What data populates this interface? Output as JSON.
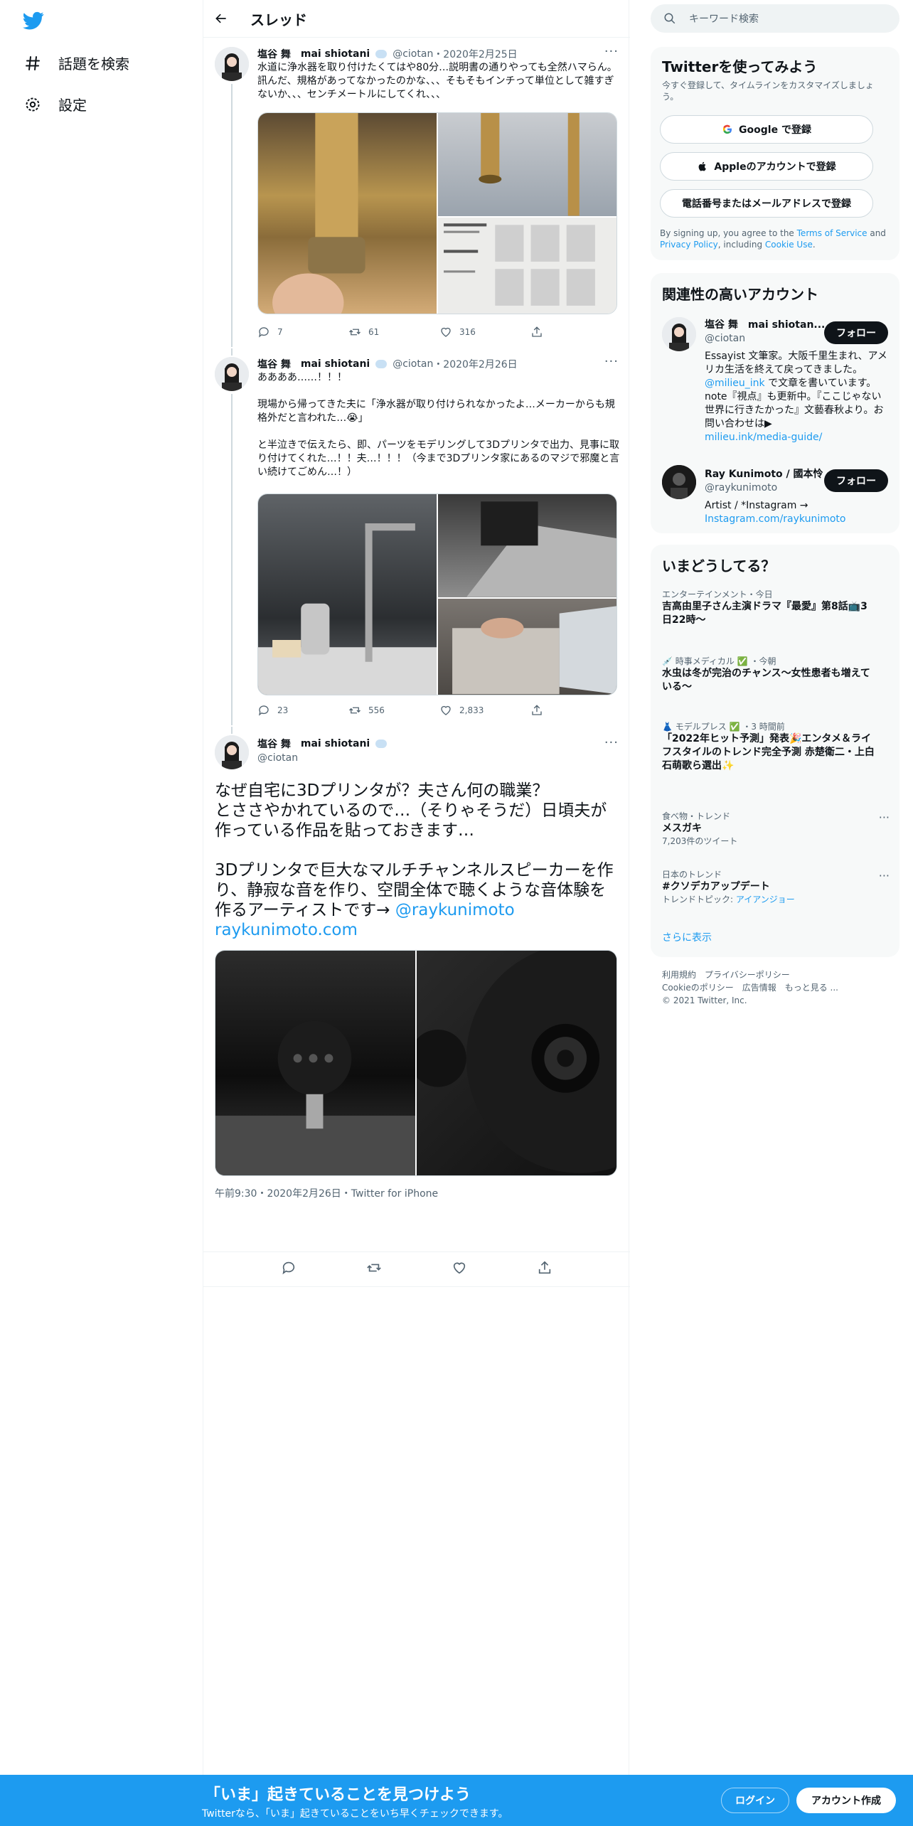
{
  "nav": {
    "explore_label": "話題を検索",
    "settings_label": "設定"
  },
  "header": {
    "title": "スレッド"
  },
  "tweets": [
    {
      "name": "塩谷 舞",
      "name_en": "mai shiotani",
      "handle": "@ciotan",
      "date": "・2020年2月25日",
      "text": "水道に浄水器を取り付けたくてはや80分…説明書の通りやっても全然ハマらん。訊んだ、規格があってなかったのかな、、、そもそもインチって単位として雑すぎないか、、、センチメートルにしてくれ、、、",
      "replies": "7",
      "retweets": "61",
      "likes": "316"
    },
    {
      "name": "塩谷 舞",
      "name_en": "mai shiotani",
      "handle": "@ciotan",
      "date": "・2020年2月26日",
      "text": "ああああ……！！！\n\n現場から帰ってきた夫に「浄水器が取り付けられなかったよ…メーカーからも規格外だと言われた…😭」\n\nと半泣きで伝えたら、即、パーツをモデリングして3Dプリンタで出力、見事に取り付けてくれた…！！夫…！！！（今まで3Dプリンタ家にあるのマジで邪魔と言い続けてごめん…！）",
      "replies": "23",
      "retweets": "556",
      "likes": "2,833"
    }
  ],
  "main_tweet": {
    "name": "塩谷 舞",
    "name_en": "mai shiotani",
    "handle": "@ciotan",
    "text": "なぜ自宅に3Dプリンタが？夫さん何の職業？\nとささやかれているので…（そりゃそうだ）日頃夫が作っている作品を貼っておきます…\n\n3Dプリンタで巨大なマルチチャンネルスピーカーを作り、静寂な音を作り、空間全体で聴くような音体験を作るアーティストです→ ",
    "mention": "@raykunimoto",
    "url": "raykunimoto.com",
    "timestamp": "午前9:30・2020年2月26日・Twitter for iPhone"
  },
  "sidebar": {
    "search_placeholder": "キーワード検索",
    "signup": {
      "title": "Twitterを使ってみよう",
      "subtitle": "今すぐ登録して、タイムラインをカスタマイズしましょう。",
      "google": "Google で登録",
      "apple": "Appleのアカウントで登録",
      "phone": "電話番号またはメールアドレスで登録",
      "terms_pre": "By signing up, you agree to the ",
      "terms_link": "Terms of Service",
      "terms_and": " and ",
      "privacy_link": "Privacy Policy",
      "including": ", including ",
      "cookie_link": "Cookie Use",
      "period": "."
    },
    "related": {
      "title": "関連性の高いアカウント",
      "follow_label": "フォロー",
      "accounts": [
        {
          "name": "塩谷 舞　mai shiotan...",
          "handle": "@ciotan",
          "bio": "Essayist 文筆家。大阪千里生まれ、アメリカ生活を終えて戻ってきました。",
          "bio_link": "@milieu_ink",
          "bio_rest": " で文章を書いています。note『視点』も更新中。『ここじゃない世界に行きたかった』文藝春秋より。お問い合わせは▶",
          "bio_url": "milieu.ink/media-guide/"
        },
        {
          "name": "Ray Kunimoto / 國本怜",
          "handle": "@raykunimoto",
          "bio": "Artist / *Instagram →",
          "bio_url": "Instagram.com/raykunimoto"
        }
      ]
    },
    "trends": {
      "title": "いまどうしてる？",
      "items": [
        {
          "cat": "エンターテインメント・今日",
          "name": "吉高由里子さん主演ドラマ『最愛』第8話📺3日22時〜",
          "sub": ""
        },
        {
          "cat": "💉 時事メディカル ✅ ・今朝",
          "name": "水虫は冬が完治のチャンス～女性患者も増えている～",
          "sub": ""
        },
        {
          "cat": "👗 モデルプレス ✅ ・3 時間前",
          "name": "「2022年ヒット予測」発表🎉エンタメ＆ライフスタイルのトレンド完全予測 赤楚衛二・上白石萌歌ら選出✨",
          "sub": ""
        },
        {
          "cat": "食べ物・トレンド",
          "name": "メスガキ",
          "sub": "7,203件のツイート"
        },
        {
          "cat": "日本のトレンド",
          "name": "#クソデカアップデート",
          "sub_pre": "トレンドトピック: ",
          "sub_link": "アイアンジョー"
        }
      ],
      "more": "さらに表示"
    },
    "footer": {
      "line1": "利用規約　プライバシーポリシー",
      "line2": "Cookieのポリシー　広告情報　もっと見る ...",
      "line3": "© 2021 Twitter, Inc."
    }
  },
  "bottom_bar": {
    "title": "「いま」起きていることを見つけよう",
    "subtitle": "Twitterなら、「いま」起きていることをいち早くチェックできます。",
    "login": "ログイン",
    "signup": "アカウント作成"
  },
  "colors": {
    "accent": "#1d9bf0",
    "text": "#0f1419",
    "secondary": "#536471"
  }
}
